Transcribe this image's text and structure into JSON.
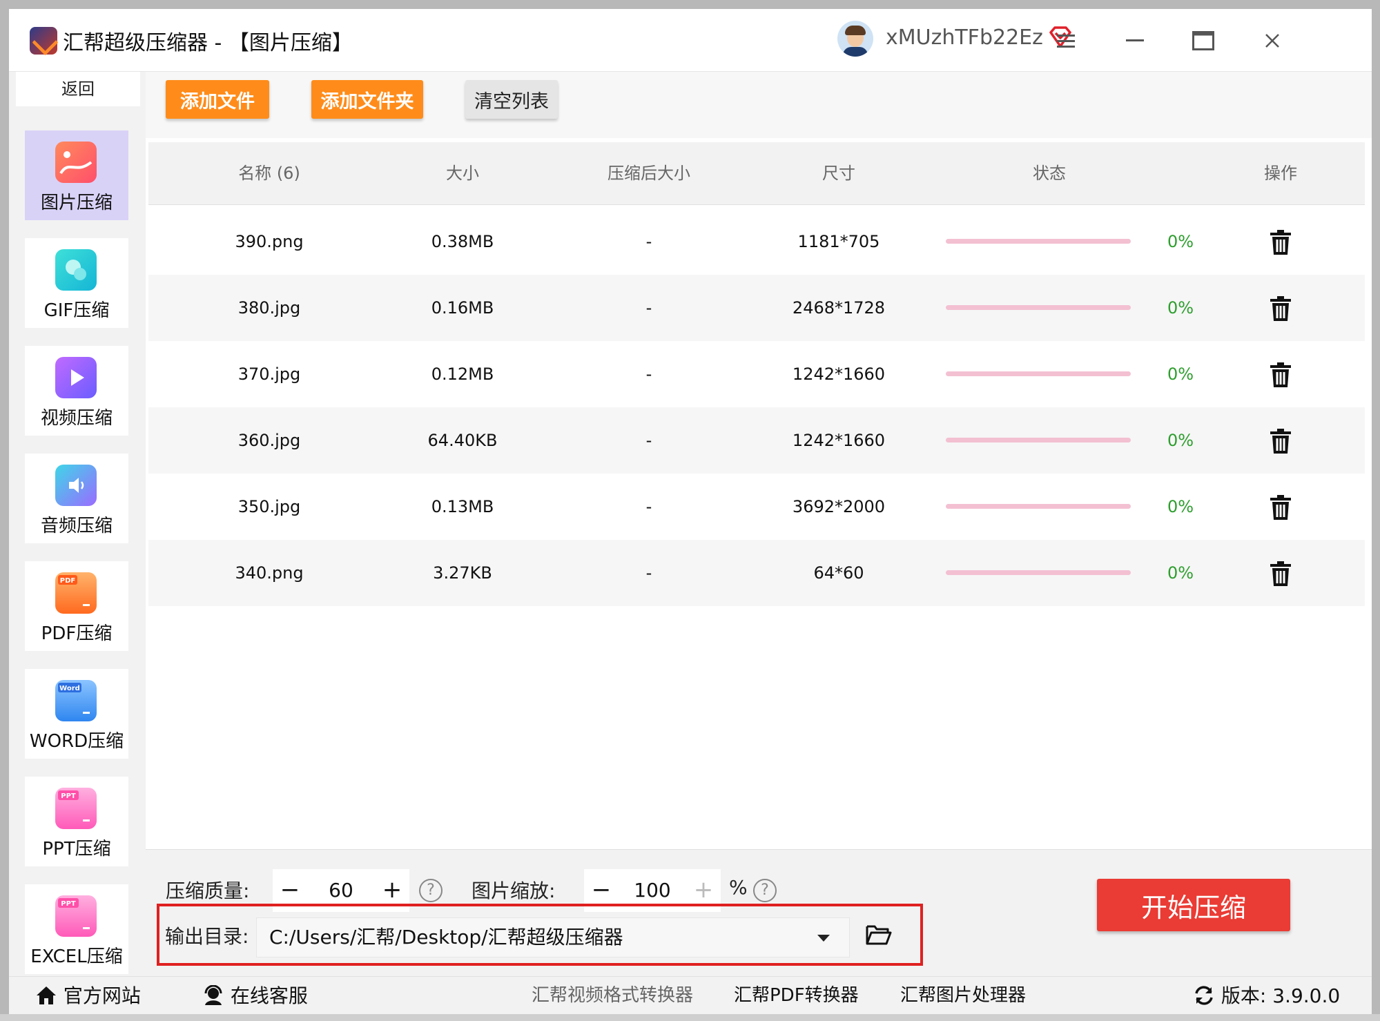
{
  "window": {
    "title": "汇帮超级压缩器  - 【图片压缩】",
    "username": "xMUzhTFb22Ez",
    "menu_icon": "hamburger-icon",
    "minimize_icon": "minimize-icon",
    "maximize_icon": "maximize-icon",
    "close_icon": "close-icon"
  },
  "sidebar": {
    "back_label": "返回",
    "items": [
      {
        "label": "图片压缩",
        "icon": "image-compress-icon",
        "active": true
      },
      {
        "label": "GIF压缩",
        "icon": "gif-compress-icon"
      },
      {
        "label": "视频压缩",
        "icon": "video-compress-icon"
      },
      {
        "label": "音频压缩",
        "icon": "audio-compress-icon"
      },
      {
        "label": "PDF压缩",
        "icon": "pdf-compress-icon",
        "badge": "PDF"
      },
      {
        "label": "WORD压缩",
        "icon": "word-compress-icon",
        "badge": "Word"
      },
      {
        "label": "PPT压缩",
        "icon": "ppt-compress-icon",
        "badge": "PPT"
      },
      {
        "label": "EXCEL压缩",
        "icon": "excel-compress-icon",
        "badge": "PPT"
      }
    ]
  },
  "toolbar": {
    "add_file": "添加文件",
    "add_folder": "添加文件夹",
    "clear_list": "清空列表"
  },
  "table": {
    "headers": {
      "name": "名称 (6)",
      "size": "大小",
      "compressed": "压缩后大小",
      "dimensions": "尺寸",
      "status": "状态",
      "actions": "操作"
    },
    "rows": [
      {
        "name": "390.png",
        "size": "0.38MB",
        "compressed": "-",
        "dimensions": "1181*705",
        "progress": "0%"
      },
      {
        "name": "380.jpg",
        "size": "0.16MB",
        "compressed": "-",
        "dimensions": "2468*1728",
        "progress": "0%"
      },
      {
        "name": "370.jpg",
        "size": "0.12MB",
        "compressed": "-",
        "dimensions": "1242*1660",
        "progress": "0%"
      },
      {
        "name": "360.jpg",
        "size": "64.40KB",
        "compressed": "-",
        "dimensions": "1242*1660",
        "progress": "0%"
      },
      {
        "name": "350.jpg",
        "size": "0.13MB",
        "compressed": "-",
        "dimensions": "3692*2000",
        "progress": "0%"
      },
      {
        "name": "340.png",
        "size": "3.27KB",
        "compressed": "-",
        "dimensions": "64*60",
        "progress": "0%"
      }
    ]
  },
  "settings": {
    "quality_label": "压缩质量:",
    "quality_value": "60",
    "scale_label": "图片缩放:",
    "scale_value": "100",
    "scale_unit": "%",
    "minus": "−",
    "plus": "+",
    "help": "?",
    "output_label": "输出目录:",
    "output_path": "C:/Users/汇帮/Desktop/汇帮超级压缩器",
    "start_button": "开始压缩"
  },
  "footer": {
    "website": "官方网站",
    "support": "在线客服",
    "links": [
      "汇帮视频格式转换器",
      "汇帮PDF转换器",
      "汇帮图片处理器"
    ],
    "version": "版本: 3.9.0.0"
  },
  "colors": {
    "accent_orange": "#ff8c1a",
    "start_red": "#ea3b34",
    "progress_pink": "#f3c0d2",
    "progress_text_green": "#2e9e2e",
    "active_sidebar": "#d9d2f7",
    "highlight_frame": "#e02020"
  }
}
